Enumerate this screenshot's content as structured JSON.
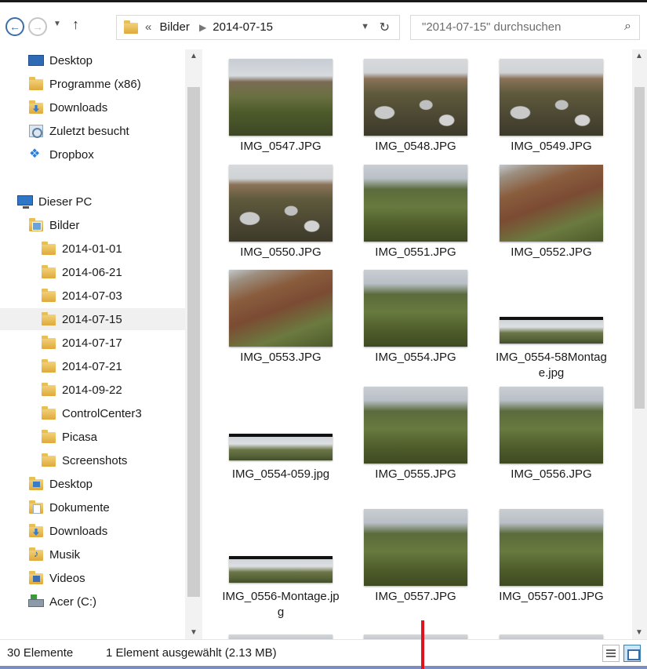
{
  "address": {
    "back_icon": "back-arrow-icon",
    "forward_icon": "forward-arrow-icon",
    "crumb_prefix": "«",
    "crumbs": [
      "Bilder",
      "2014-07-15"
    ],
    "refresh_icon": "refresh-icon"
  },
  "search": {
    "placeholder": "\"2014-07-15\" durchsuchen",
    "icon": "search-icon"
  },
  "nav": {
    "favorites": [
      {
        "label": "Desktop",
        "icon": "desktop-icon"
      },
      {
        "label": "Programme (x86)",
        "icon": "folder-icon"
      },
      {
        "label": "Downloads",
        "icon": "downloads-folder-icon"
      },
      {
        "label": "Zuletzt besucht",
        "icon": "recent-places-icon"
      },
      {
        "label": "Dropbox",
        "icon": "dropbox-icon"
      }
    ],
    "pc": {
      "label": "Dieser PC",
      "icon": "computer-icon"
    },
    "bilder": {
      "label": "Bilder",
      "icon": "pictures-folder-icon"
    },
    "bilder_children": [
      {
        "label": "2014-01-01"
      },
      {
        "label": "2014-06-21"
      },
      {
        "label": "2014-07-03"
      },
      {
        "label": "2014-07-15",
        "selected": true
      },
      {
        "label": "2014-07-17"
      },
      {
        "label": "2014-07-21"
      },
      {
        "label": "2014-09-22"
      },
      {
        "label": "ControlCenter3"
      },
      {
        "label": "Picasa"
      },
      {
        "label": "Screenshots"
      }
    ],
    "pc_children": [
      {
        "label": "Desktop",
        "icon": "desktop-folder-icon"
      },
      {
        "label": "Dokumente",
        "icon": "documents-folder-icon"
      },
      {
        "label": "Downloads",
        "icon": "downloads-folder-icon"
      },
      {
        "label": "Musik",
        "icon": "music-folder-icon"
      },
      {
        "label": "Videos",
        "icon": "videos-folder-icon"
      },
      {
        "label": "Acer (C:)",
        "icon": "drive-icon"
      }
    ]
  },
  "files": [
    {
      "name": "IMG_0547.JPG",
      "style": "mtn"
    },
    {
      "name": "IMG_0548.JPG",
      "style": "rock"
    },
    {
      "name": "IMG_0549.JPG",
      "style": "rock"
    },
    {
      "name": "IMG_0550.JPG",
      "style": "rock"
    },
    {
      "name": "IMG_0551.JPG",
      "style": "green"
    },
    {
      "name": "IMG_0552.JPG",
      "style": "red"
    },
    {
      "name": "IMG_0553.JPG",
      "style": "red"
    },
    {
      "name": "IMG_0554.JPG",
      "style": "green"
    },
    {
      "name": "IMG_0554-58Montage.jpg",
      "style": "pano"
    },
    {
      "name": "IMG_0554-059.jpg",
      "style": "pano"
    },
    {
      "name": "IMG_0555.JPG",
      "style": "green"
    },
    {
      "name": "IMG_0556.JPG",
      "style": "green"
    },
    {
      "name": "IMG_0556-Montage.jpg",
      "style": "pano"
    },
    {
      "name": "IMG_0557.JPG",
      "style": "green"
    },
    {
      "name": "IMG_0557-001.JPG",
      "style": "green"
    }
  ],
  "status": {
    "count": "30 Elemente",
    "selection": "1 Element ausgewählt (2.13 MB)"
  },
  "view_buttons": {
    "details_icon": "details-view-icon",
    "tiles_icon": "large-icons-view-icon"
  }
}
